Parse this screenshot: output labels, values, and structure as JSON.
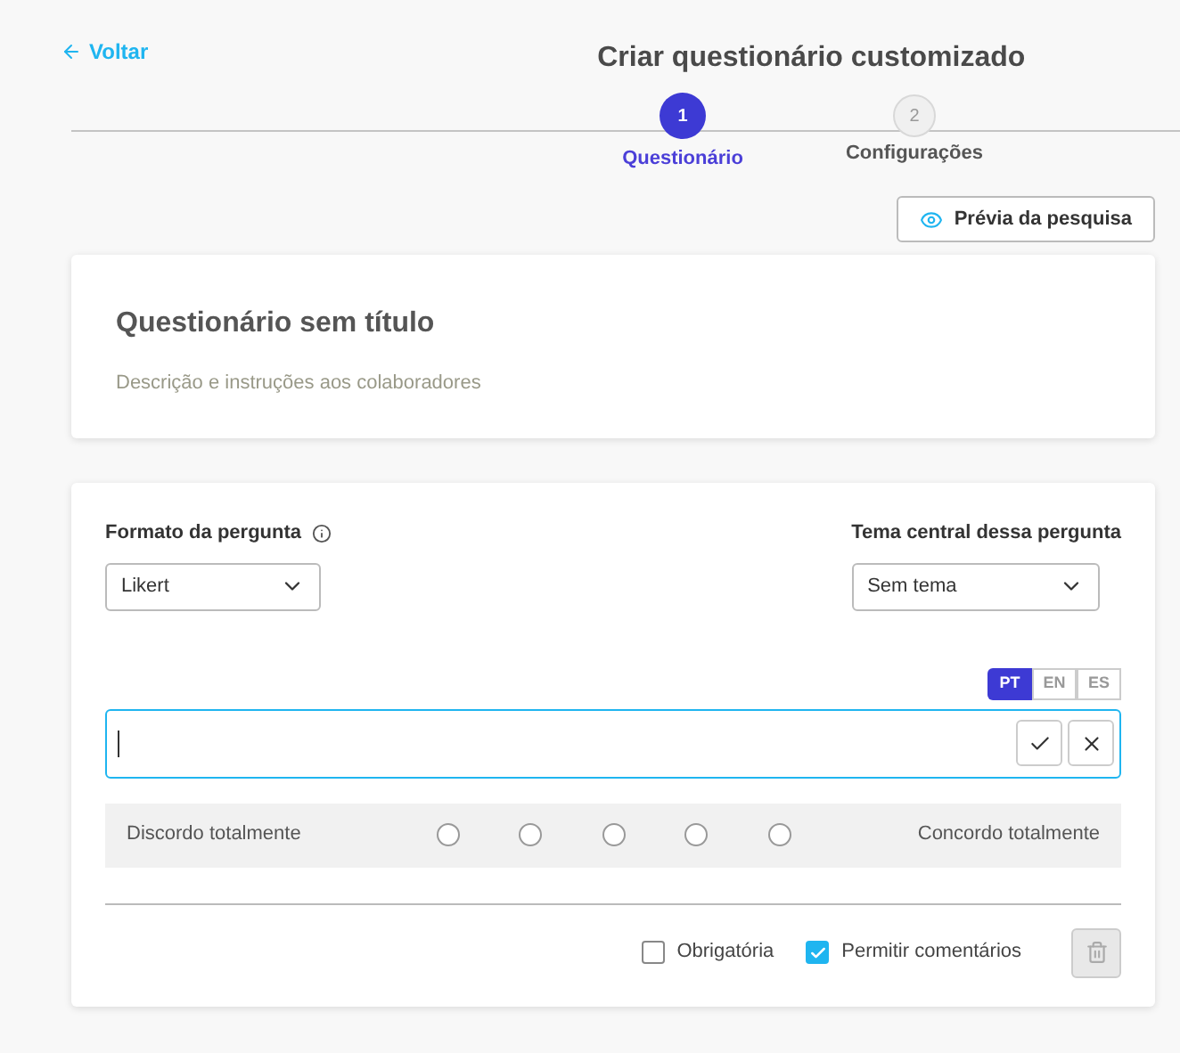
{
  "back_link": "Voltar",
  "title": "Criar questionário customizado",
  "steps": [
    {
      "number": "1",
      "label": "Questionário",
      "selected": true
    },
    {
      "number": "2",
      "label": "Configurações",
      "selected": false
    }
  ],
  "preview_button": "Prévia da pesquisa",
  "header_card": {
    "title": "Questionário sem título",
    "description": "Descrição e instruções aos colaboradores"
  },
  "question": {
    "format_label": "Formato da pergunta",
    "format_value": "Likert",
    "theme_label": "Tema central dessa pergunta",
    "theme_value": "Sem tema",
    "languages": [
      {
        "code": "PT",
        "selected": true
      },
      {
        "code": "EN",
        "selected": false
      },
      {
        "code": "ES",
        "selected": false
      }
    ],
    "scale_left": "Discordo totalmente",
    "scale_right": "Concordo totalmente",
    "scale_options": [
      {
        "selected": false
      },
      {
        "selected": false
      },
      {
        "selected": false
      },
      {
        "selected": false
      },
      {
        "selected": false
      }
    ],
    "options": [
      {
        "label": "Obrigatória",
        "checked": false
      },
      {
        "label": "Permitir comentários",
        "checked": true
      }
    ]
  }
}
